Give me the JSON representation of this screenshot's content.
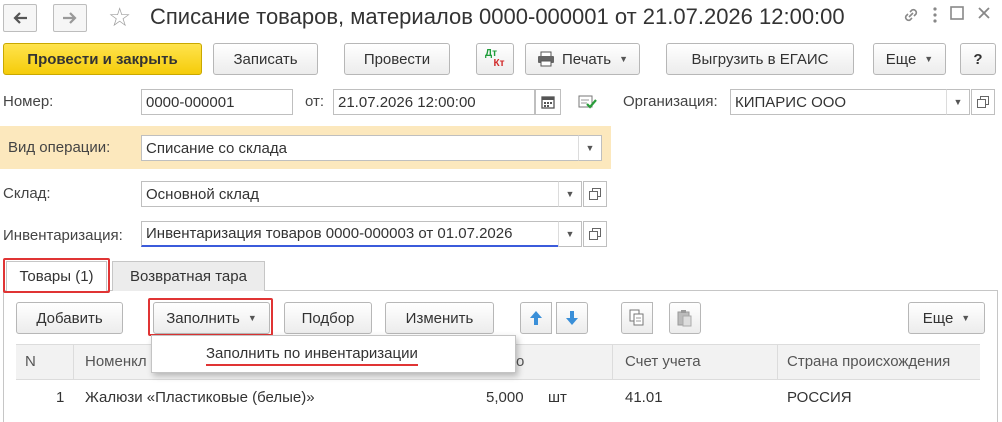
{
  "window": {
    "title": "Списание товаров, материалов 0000-000001 от 21.07.2026 12:00:00",
    "back_icon": "arrow-left-icon",
    "forward_icon": "arrow-right-icon",
    "favorite_icon": "star-icon",
    "link_icon": "link-icon",
    "menu_icon": "more-vertical-icon",
    "maximize_icon": "maximize-icon",
    "close_icon": "close-icon"
  },
  "toolbar": {
    "post_and_close": "Провести и закрыть",
    "save": "Записать",
    "post": "Провести",
    "dt_kt_top": "Дт",
    "dt_kt_bottom": "Кт",
    "print": "Печать",
    "export_egais": "Выгрузить в ЕГАИС",
    "more": "Еще",
    "help": "?"
  },
  "form": {
    "number_label": "Номер:",
    "number_value": "0000-000001",
    "date_label": "от:",
    "date_value": "21.07.2026 12:00:00",
    "org_label": "Организация:",
    "org_value": "КИПАРИС ООО",
    "operation_label": "Вид операции:",
    "operation_value": "Списание со склада",
    "warehouse_label": "Склад:",
    "warehouse_value": "Основной склад",
    "inventory_label": "Инвентаризация:",
    "inventory_value": "Инвентаризация товаров 0000-000003 от 01.07.2026"
  },
  "tabs": [
    {
      "label": "Товары (1)",
      "active": true
    },
    {
      "label": "Возвратная тара",
      "active": false
    }
  ],
  "table_toolbar": {
    "add": "Добавить",
    "fill": "Заполнить",
    "selection": "Подбор",
    "change": "Изменить",
    "more": "Еще"
  },
  "fill_menu": {
    "items": [
      "Заполнить по инвентаризации"
    ]
  },
  "table": {
    "columns": [
      "N",
      "Номенкл",
      "о",
      "Счет учета",
      "Страна происхождения"
    ],
    "rows": [
      {
        "n": "1",
        "item": "Жалюзи «Пластиковые (белые)»",
        "qty": "5,000",
        "unit": "шт",
        "account": "41.01",
        "country": "РОССИЯ"
      }
    ]
  },
  "colors": {
    "primary_button": "#f5cc0a",
    "highlight_band": "#fce8bd",
    "focus_underline": "#3b5bdb",
    "annotation_red": "#e03434"
  }
}
